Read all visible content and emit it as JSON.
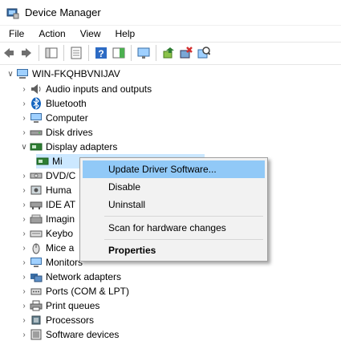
{
  "window": {
    "title": "Device Manager"
  },
  "menubar": {
    "items": [
      "File",
      "Action",
      "View",
      "Help"
    ]
  },
  "toolbar": {
    "icons": [
      "back-arrow-icon",
      "forward-arrow-icon",
      "show-hide-tree-icon",
      "properties-icon",
      "help-icon",
      "action-pane-icon",
      "display-icon",
      "update-driver-icon",
      "uninstall-icon",
      "scan-hardware-icon"
    ]
  },
  "tree": {
    "root": "WIN-FKQHBVNIJAV",
    "items": [
      "Audio inputs and outputs",
      "Bluetooth",
      "Computer",
      "Disk drives",
      "Display adapters",
      "Mi",
      "DVD/C",
      "Huma",
      "IDE AT",
      "Imagin",
      "Keybo",
      "Mice a",
      "Monitors",
      "Network adapters",
      "Ports (COM & LPT)",
      "Print queues",
      "Processors",
      "Software devices"
    ]
  },
  "context_menu": {
    "update": "Update Driver Software...",
    "disable": "Disable",
    "uninstall": "Uninstall",
    "scan": "Scan for hardware changes",
    "properties": "Properties"
  },
  "colors": {
    "selection": "#cce8ff",
    "menu_highlight": "#91c9f7"
  }
}
